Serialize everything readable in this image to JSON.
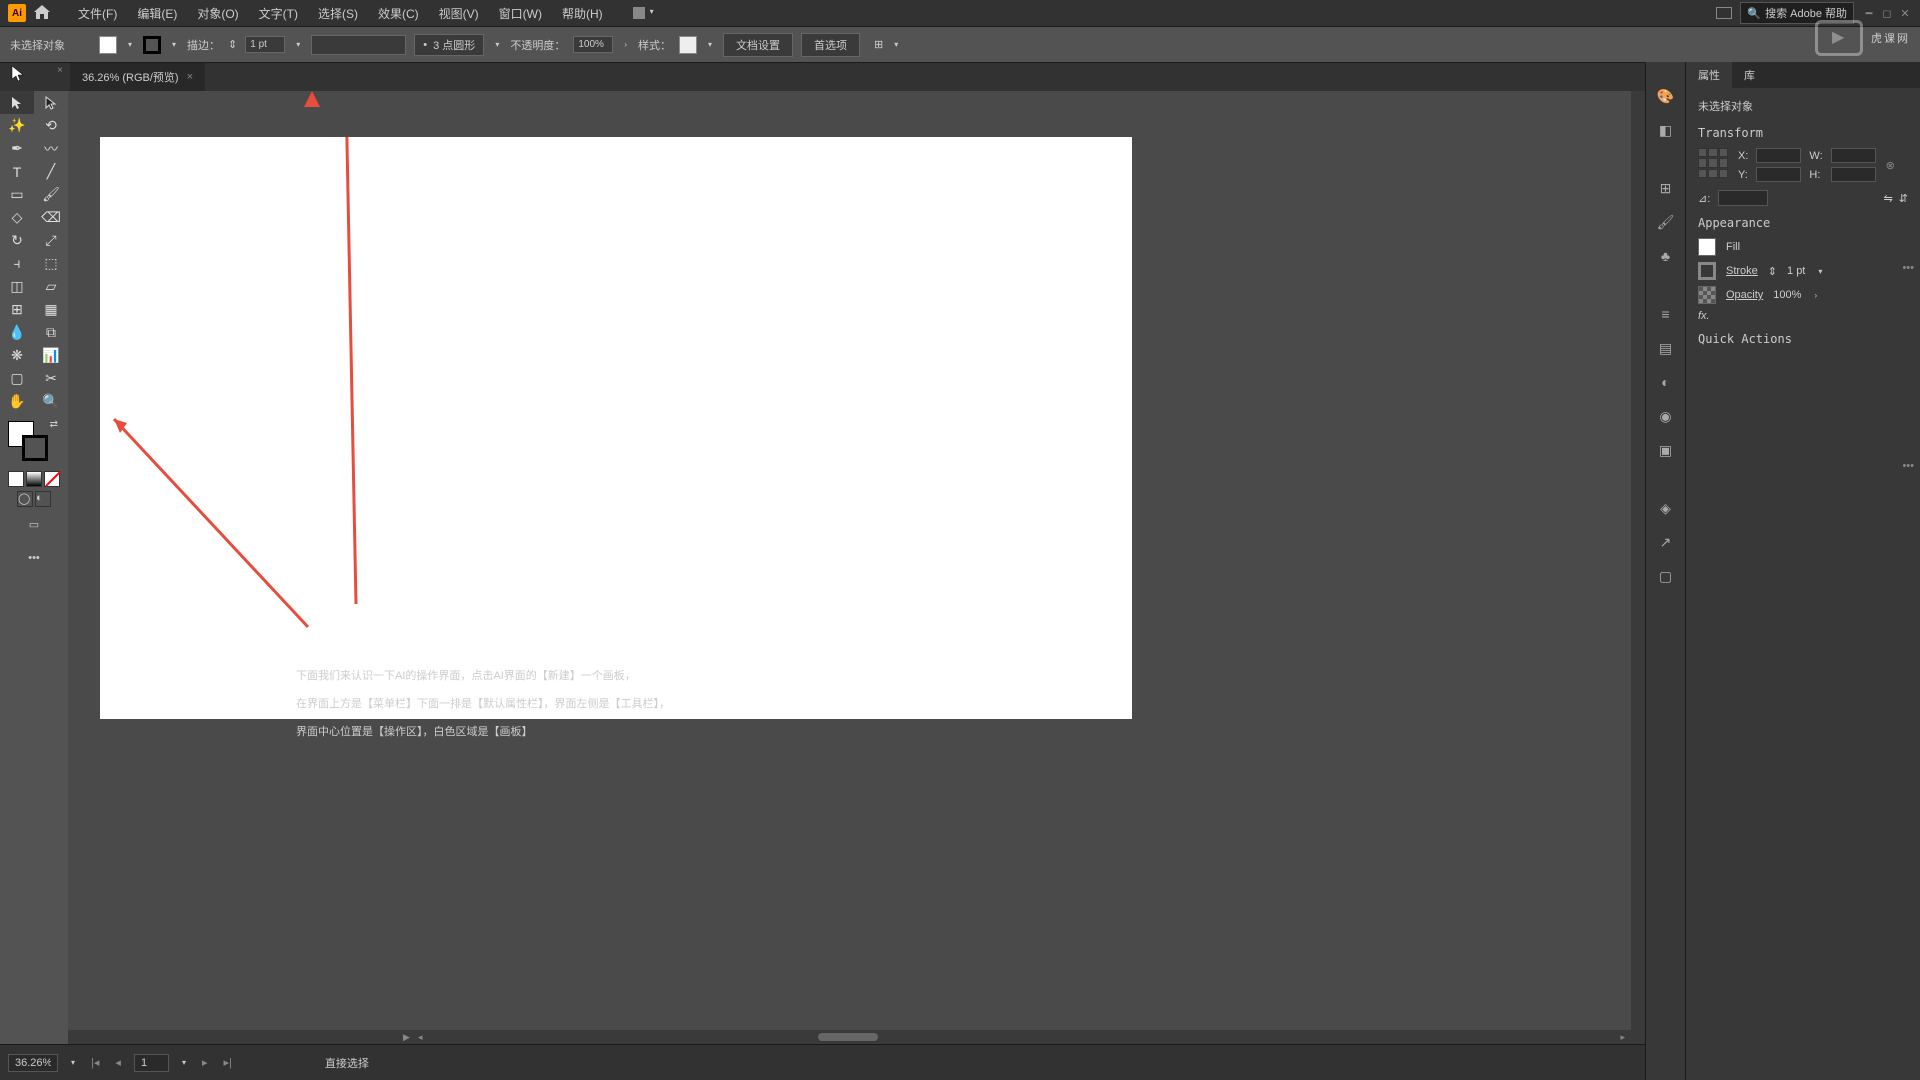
{
  "menubar": {
    "items": [
      "文件(F)",
      "编辑(E)",
      "对象(O)",
      "文字(T)",
      "选择(S)",
      "效果(C)",
      "视图(V)",
      "窗口(W)",
      "帮助(H)"
    ],
    "search_placeholder": "搜索 Adobe 帮助"
  },
  "options": {
    "no_selection": "未选择对象",
    "stroke_label": "描边：",
    "stroke_value": "1 pt",
    "dash_label": "3 点圆形",
    "opacity_label": "不透明度：",
    "opacity_value": "100%",
    "style_label": "样式：",
    "doc_setup": "文档设置",
    "prefs": "首选项"
  },
  "tab": {
    "label": "36.26% (RGB/预览)"
  },
  "panels": {
    "tabs": [
      "属性",
      "库"
    ],
    "no_selection": "未选择对象",
    "transform": "Transform",
    "x": "X:",
    "y": "Y:",
    "w": "W:",
    "h": "H:",
    "angle": "⊿:",
    "appearance": "Appearance",
    "fill": "Fill",
    "stroke": "Stroke",
    "stroke_val": "1 pt",
    "opacity": "Opacity",
    "opacity_val": "100%",
    "fx": "fx.",
    "quick": "Quick Actions"
  },
  "status": {
    "zoom": "36.26%",
    "artboard": "1",
    "tool": "直接选择",
    "play": "▶"
  },
  "annotation": {
    "line1": "下面我们来认识一下AI的操作界面，点击AI界面的【新建】一个画板，",
    "line2": "在界面上方是【菜单栏】下面一排是【默认属性栏】，界面左侧是【工具栏】，",
    "line3": "界面中心位置是【操作区】，白色区域是【画板】"
  },
  "watermark": "虎课网"
}
